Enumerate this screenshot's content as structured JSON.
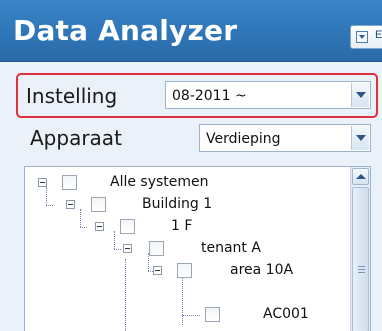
{
  "header": {
    "title": "Data Analyzer",
    "menu_button_label": "E"
  },
  "filters": {
    "instelling": {
      "label": "Instelling",
      "value": "08-2011 ~"
    },
    "apparaat": {
      "label": "Apparaat",
      "value": "Verdieping"
    }
  },
  "tree": {
    "nodes": [
      {
        "label": "Alle systemen"
      },
      {
        "label": "Building 1"
      },
      {
        "label": "1 F"
      },
      {
        "label": "tenant A"
      },
      {
        "label": "area 10A"
      },
      {
        "label": "AC001"
      }
    ]
  },
  "colors": {
    "header_blue": "#2f77b9",
    "highlight_red": "#e0303a",
    "panel_bg": "#eaf1f8"
  }
}
